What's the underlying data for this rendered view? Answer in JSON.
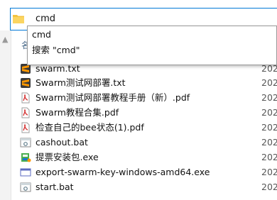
{
  "address_bar": {
    "value": "cmd"
  },
  "suggestions": [
    {
      "label": "cmd"
    },
    {
      "label": "搜索 \"cmd\""
    }
  ],
  "columns": {
    "name": "名",
    "date": "202"
  },
  "files": [
    {
      "name": "swarm.txt",
      "icon": "sublime-text-icon",
      "date": "202"
    },
    {
      "name": "Swarm测试网部署.txt",
      "icon": "sublime-text-icon",
      "date": "202"
    },
    {
      "name": "Swarm测试网部署教程手册（新）.pdf",
      "icon": "pdf-icon",
      "date": "202"
    },
    {
      "name": "Swarm教程合集.pdf",
      "icon": "pdf-icon",
      "date": "202"
    },
    {
      "name": "检查自己的bee状态(1).pdf",
      "icon": "pdf-icon",
      "date": "202"
    },
    {
      "name": "cashout.bat",
      "icon": "batch-file-icon",
      "date": "202"
    },
    {
      "name": "提票安装包.exe",
      "icon": "installer-icon",
      "date": "202"
    },
    {
      "name": "export-swarm-key-windows-amd64.exe",
      "icon": "executable-icon",
      "date": "202"
    },
    {
      "name": "start.bat",
      "icon": "batch-file-icon",
      "date": "202"
    }
  ],
  "colors": {
    "accent": "#0078d7",
    "pdf_red": "#d32f2f",
    "sublime_orange": "#ff9800"
  }
}
